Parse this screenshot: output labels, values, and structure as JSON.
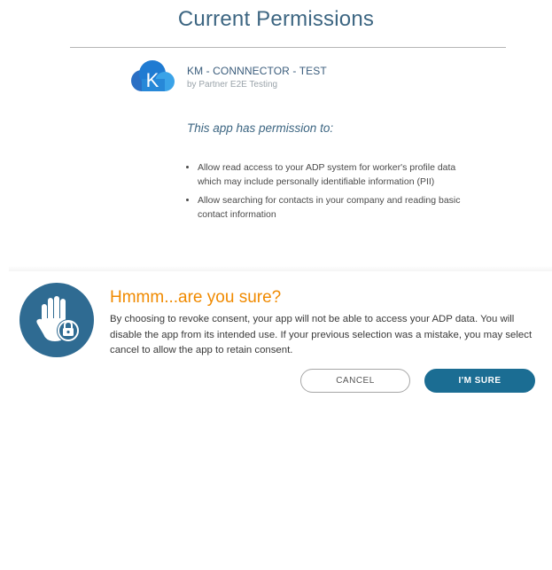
{
  "page": {
    "title": "Current Permissions"
  },
  "app": {
    "name": "KM - CONNNECTOR - TEST",
    "publisher": "by Partner E2E Testing",
    "logo_letter": "K",
    "logo_icon": "cloud-k-logo"
  },
  "permissions": {
    "heading": "This app has permission to:",
    "items": [
      "Allow read access to your ADP system for worker's profile data which may include personally identifiable information (PII)",
      "Allow searching for contacts in your company and reading basic contact information"
    ]
  },
  "dialog": {
    "icon": "hand-lock-icon",
    "title": "Hmmm...are you sure?",
    "message": "By choosing to revoke consent, your app will not be able to access your ADP data. You will disable the app from its intended use. If your previous selection was a mistake, you may select cancel to allow the app to retain consent.",
    "cancel_label": "CANCEL",
    "confirm_label": "I'M SURE"
  },
  "colors": {
    "title": "#3d6682",
    "accent_orange": "#f08a00",
    "primary_button": "#1b6d93",
    "logo_blue": "#1f7bd2",
    "icon_circle": "#2f6b92"
  }
}
